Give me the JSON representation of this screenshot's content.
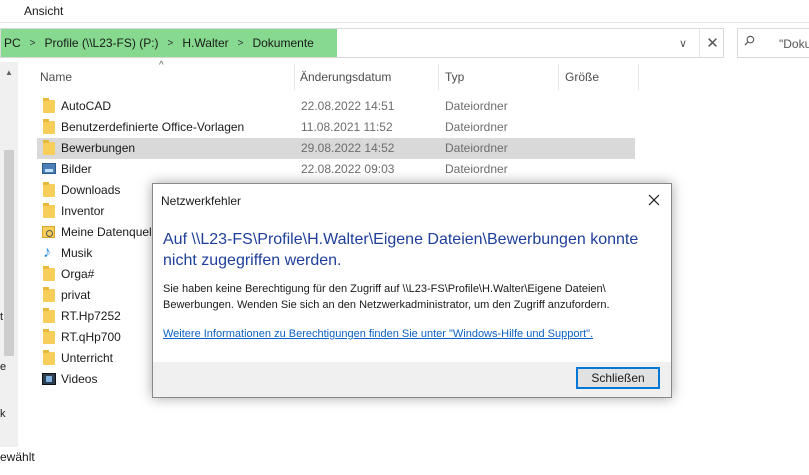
{
  "ribbon": {
    "tab_label": "Ansicht"
  },
  "address": {
    "crumbs": [
      "PC",
      "Profile (\\\\L23-FS) (P:)",
      "H.Walter",
      "Dokumente"
    ],
    "separator": ">",
    "dropdown_glyph": "∨",
    "clear_glyph": "✕",
    "path_highlight_color": "#86d98f"
  },
  "search": {
    "text": "\"Doku",
    "icon": "search-icon"
  },
  "columns": {
    "name": "Name",
    "date": "Änderungsdatum",
    "type": "Typ",
    "size": "Größe",
    "sort_glyph": "^"
  },
  "rows": [
    {
      "name": "AutoCAD",
      "date": "22.08.2022 14:51",
      "type": "Dateiordner",
      "icon": "folder-icon"
    },
    {
      "name": "Benutzerdefinierte Office-Vorlagen",
      "date": "11.08.2021 11:52",
      "type": "Dateiordner",
      "icon": "folder-icon"
    },
    {
      "name": "Bewerbungen",
      "date": "29.08.2022 14:52",
      "type": "Dateiordner",
      "icon": "folder-icon",
      "selected": true
    },
    {
      "name": "Bilder",
      "date": "22.08.2022 09:03",
      "type": "Dateiordner",
      "icon": "pictures-icon"
    },
    {
      "name": "Downloads",
      "date": "",
      "type": "",
      "icon": "folder-icon"
    },
    {
      "name": "Inventor",
      "date": "",
      "type": "",
      "icon": "folder-icon"
    },
    {
      "name": "Meine Datenquel",
      "date": "",
      "type": "",
      "icon": "datasource-folder-icon"
    },
    {
      "name": "Musik",
      "date": "",
      "type": "",
      "icon": "music-icon"
    },
    {
      "name": "Orga#",
      "date": "",
      "type": "",
      "icon": "folder-icon"
    },
    {
      "name": "privat",
      "date": "",
      "type": "",
      "icon": "folder-icon"
    },
    {
      "name": "RT.Hp7252",
      "date": "",
      "type": "",
      "icon": "folder-icon"
    },
    {
      "name": "RT.qHp700",
      "date": "",
      "type": "",
      "icon": "folder-icon"
    },
    {
      "name": "Unterricht",
      "date": "",
      "type": "",
      "icon": "folder-icon"
    },
    {
      "name": "Videos",
      "date": "",
      "type": "",
      "icon": "videos-icon"
    }
  ],
  "status": {
    "text": "ewählt"
  },
  "left_edge_chars": [
    "t",
    "e",
    "k"
  ],
  "dialog": {
    "title": "Netzwerkfehler",
    "heading": "Auf \\\\L23-FS\\Profile\\H.Walter\\Eigene Dateien\\Bewerbungen konnte nicht zugegriffen werden.",
    "message": "Sie haben keine Berechtigung für den Zugriff auf \\\\L23-FS\\Profile\\H.Walter\\Eigene Dateien\\ Bewerbungen. Wenden Sie sich an den Netzwerkadministrator, um den Zugriff anzufordern.",
    "link": "Weitere Informationen zu Berechtigungen finden Sie unter \"Windows-Hilfe und Support\".",
    "button": "Schließen",
    "heading_color": "#1e3f9b",
    "link_color": "#0b61c4"
  }
}
